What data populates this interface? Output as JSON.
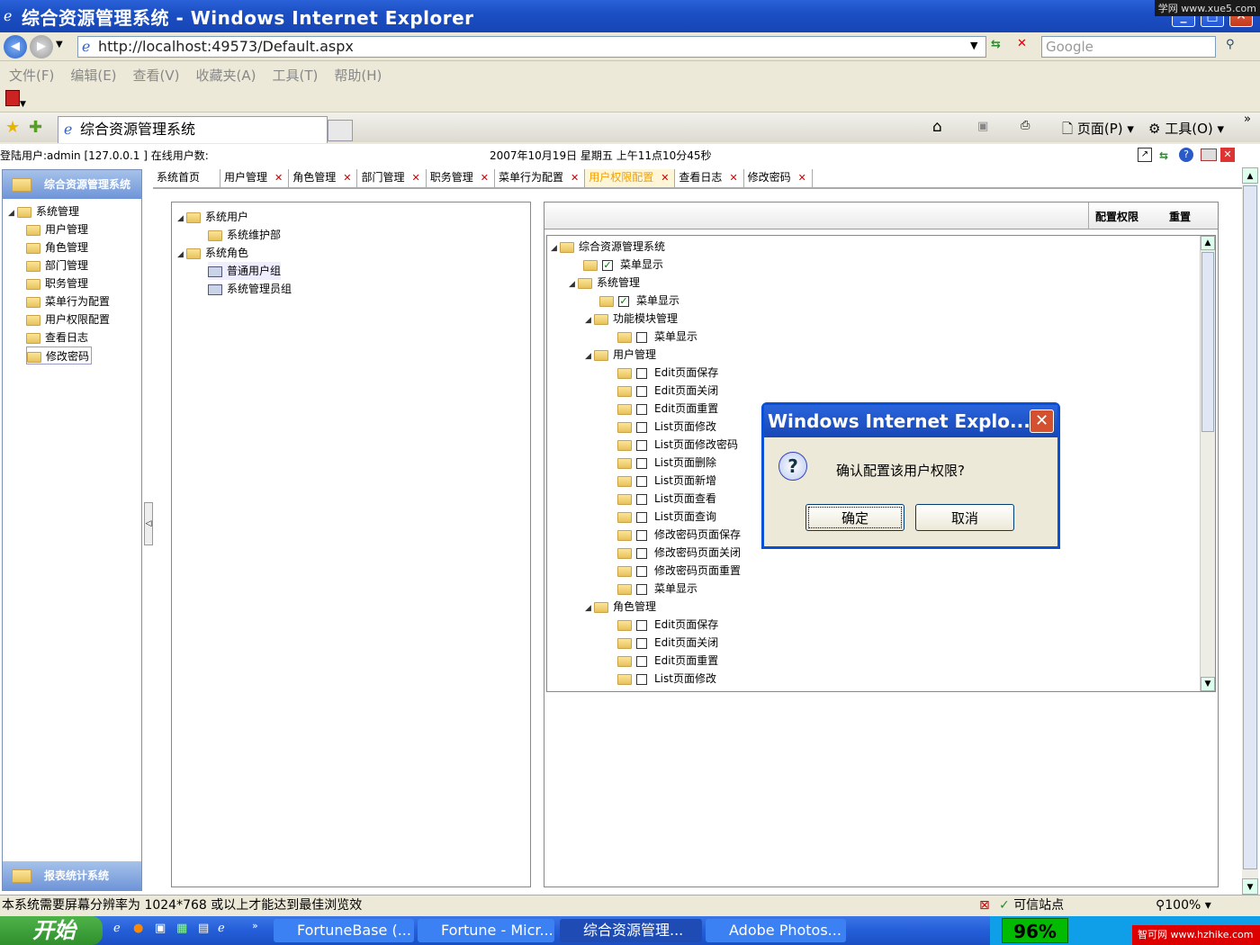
{
  "window": {
    "title": "综合资源管理系统 - Windows Internet Explorer",
    "watermark": "学网 www.xue5.com"
  },
  "address": {
    "url": "http://localhost:49573/Default.aspx",
    "search_placeholder": "Google"
  },
  "menu": [
    "文件(F)",
    "编辑(E)",
    "查看(V)",
    "收藏夹(A)",
    "工具(T)",
    "帮助(H)"
  ],
  "browser_tab": {
    "label": "综合资源管理系统"
  },
  "toolbar_right": {
    "page": "页面(P)",
    "tools": "工具(O)"
  },
  "info": {
    "login": "登陆用户:admin [127.0.0.1 ] 在线用户数:",
    "datetime": "2007年10月19日 星期五 上午11点10分45秒"
  },
  "left_panel": {
    "header": "综合资源管理系统",
    "footer": "报表统计系统",
    "root": "系统管理",
    "items": [
      "用户管理",
      "角色管理",
      "部门管理",
      "职务管理",
      "菜单行为配置",
      "用户权限配置",
      "查看日志",
      "修改密码"
    ]
  },
  "page_tabs": [
    "系统首页",
    "用户管理",
    "角色管理",
    "部门管理",
    "职务管理",
    "菜单行为配置",
    "用户权限配置",
    "查看日志",
    "修改密码"
  ],
  "user_tree": {
    "users_root": "系统用户",
    "users": [
      "系统维护部"
    ],
    "roles_root": "系统角色",
    "roles": [
      "普通用户组",
      "系统管理员组"
    ]
  },
  "right_toolbar": {
    "config": "配置权限",
    "reset": "重置"
  },
  "perm_tree": {
    "root": "综合资源管理系统",
    "rows": [
      {
        "label": "菜单显示",
        "checked": true
      },
      {
        "label": "系统管理",
        "group": true
      },
      {
        "label": "菜单显示",
        "checked": true
      },
      {
        "label": "功能模块管理",
        "group": true
      },
      {
        "label": "菜单显示",
        "checked": false
      },
      {
        "label": "用户管理",
        "group": true
      },
      {
        "label": "Edit页面保存",
        "checked": false
      },
      {
        "label": "Edit页面关闭",
        "checked": false
      },
      {
        "label": "Edit页面重置",
        "checked": false
      },
      {
        "label": "List页面修改",
        "checked": false
      },
      {
        "label": "List页面修改密码",
        "checked": false
      },
      {
        "label": "List页面删除",
        "checked": false
      },
      {
        "label": "List页面新增",
        "checked": false
      },
      {
        "label": "List页面查看",
        "checked": false
      },
      {
        "label": "List页面查询",
        "checked": false
      },
      {
        "label": "修改密码页面保存",
        "checked": false
      },
      {
        "label": "修改密码页面关闭",
        "checked": false
      },
      {
        "label": "修改密码页面重置",
        "checked": false
      },
      {
        "label": "菜单显示",
        "checked": false
      },
      {
        "label": "角色管理",
        "group": true
      },
      {
        "label": "Edit页面保存",
        "checked": false
      },
      {
        "label": "Edit页面关闭",
        "checked": false
      },
      {
        "label": "Edit页面重置",
        "checked": false
      },
      {
        "label": "List页面修改",
        "checked": false
      }
    ]
  },
  "dialog": {
    "title": "Windows Internet Explo...",
    "message": "确认配置该用户权限?",
    "ok": "确定",
    "cancel": "取消"
  },
  "status": {
    "text": "本系统需要屏幕分辨率为 1024*768 或以上才能达到最佳浏览效",
    "zone": "可信站点",
    "zoom": "100%"
  },
  "taskbar": {
    "start": "开始",
    "tasks": [
      "FortuneBase (...",
      "Fortune - Micr...",
      "综合资源管理...",
      "Adobe Photos..."
    ],
    "battery": "96%",
    "brand": "智可网 www.hzhike.com"
  }
}
